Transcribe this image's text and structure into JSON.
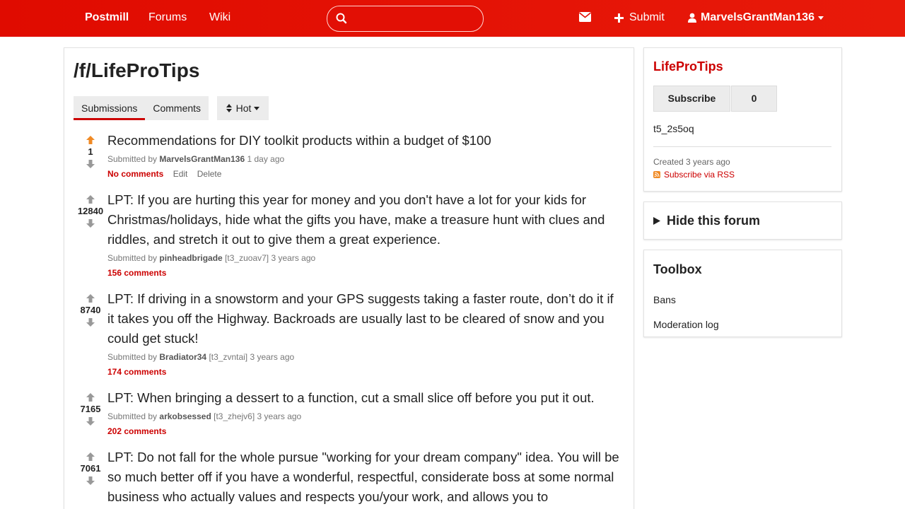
{
  "header": {
    "brand": "Postmill",
    "nav": [
      "Forums",
      "Wiki"
    ],
    "search": {
      "value": "",
      "placeholder": ""
    },
    "submit_label": "Submit",
    "username": "MarvelsGrantMan136"
  },
  "forum": {
    "title": "/f/LifeProTips",
    "tabs": [
      "Submissions",
      "Comments"
    ],
    "active_tab": "Submissions",
    "sort_label": "Hot"
  },
  "posts": [
    {
      "score": "1",
      "upvoted": true,
      "title": "Recommendations for DIY toolkit products within a budget of $100",
      "submitted_by": "Submitted by",
      "author": "MarvelsGrantMan136",
      "id_tag": "",
      "time": "1 day ago",
      "comments": "No comments",
      "edit": "Edit",
      "delete": "Delete"
    },
    {
      "score": "12840",
      "upvoted": false,
      "title": "LPT: If you are hurting this year for money and you don't have a lot for your kids for Christmas/holidays, hide what the gifts you have, make a treasure hunt with clues and riddles, and stretch it out to give them a great experience.",
      "submitted_by": "Submitted by",
      "author": "pinheadbrigade",
      "id_tag": "[t3_zuoav7]",
      "time": "3 years ago",
      "comments": "156 comments"
    },
    {
      "score": "8740",
      "upvoted": false,
      "title": "LPT: If driving in a snowstorm and your GPS suggests taking a faster route, don’t do it if it takes you off the Highway. Backroads are usually last to be cleared of snow and you could get stuck!",
      "submitted_by": "Submitted by",
      "author": "Bradiator34",
      "id_tag": "[t3_zvntai]",
      "time": "3 years ago",
      "comments": "174 comments"
    },
    {
      "score": "7165",
      "upvoted": false,
      "title": "LPT: When bringing a dessert to a function, cut a small slice off before you put it out.",
      "submitted_by": "Submitted by",
      "author": "arkobsessed",
      "id_tag": "[t3_zhejv6]",
      "time": "3 years ago",
      "comments": "202 comments"
    },
    {
      "score": "7061",
      "upvoted": false,
      "title": "LPT: Do not fall for the whole pursue \"working for your dream company\" idea. You will be so much better off if you have a wonderful, respectful, considerate boss at some normal business who actually values and respects you/your work, and allows you to"
    }
  ],
  "sidebar": {
    "forum_name": "LifeProTips",
    "subscribe_label": "Subscribe",
    "subscriber_count": "0",
    "forum_id": "t5_2s5oq",
    "created": "Created 3 years ago",
    "rss_label": "Subscribe via RSS",
    "hide_label": "Hide this forum",
    "toolbox_title": "Toolbox",
    "toolbox_links": [
      "Bans",
      "Moderation log"
    ]
  },
  "colors": {
    "brand_red": "#e00b00",
    "link_red": "#cc0000",
    "upvote_orange": "#f08a24",
    "vote_gray": "#999999"
  },
  "icons": {
    "search": "search-icon",
    "mail": "envelope-icon",
    "submit": "plus-icon",
    "user": "user-icon",
    "dropdown": "caret-down-icon",
    "sort": "sort-icon",
    "upvote": "arrow-up-icon",
    "downvote": "arrow-down-icon",
    "rss": "rss-icon",
    "disclosure": "triangle-right-icon"
  }
}
